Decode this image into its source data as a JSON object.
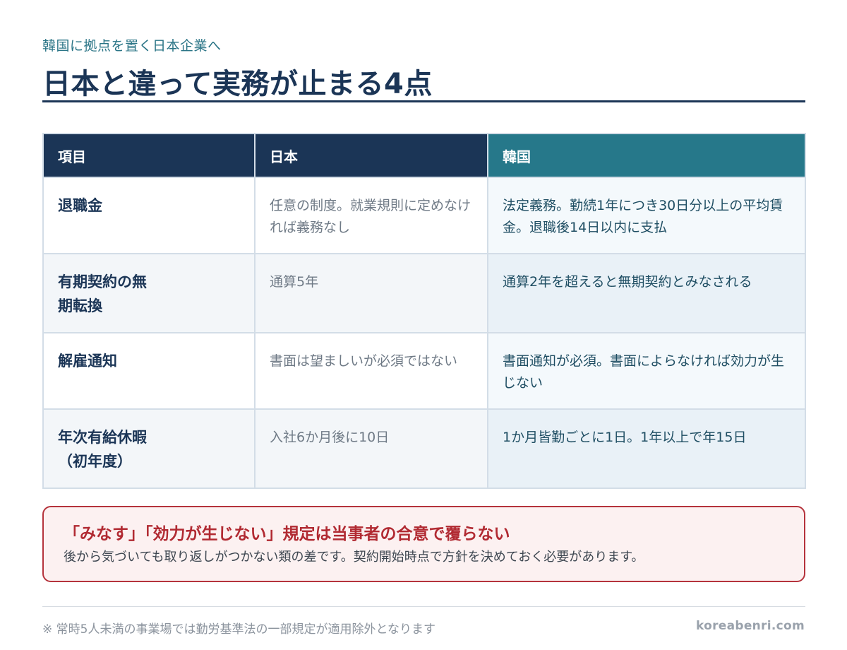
{
  "header": {
    "eyebrow": "韓国に拠点を置く日本企業へ",
    "title": "日本と違って実務が止まる4点"
  },
  "table": {
    "columns": [
      "項目",
      "日本",
      "韓国"
    ],
    "rows": [
      {
        "item": "退職金",
        "japan": "任意の制度。就業規則に定めなければ義務なし",
        "korea": "法定義務。勤続1年につき30日分以上の平均賃金。退職後14日以内に支払"
      },
      {
        "item": "有期契約の無期転換",
        "japan": "通算5年",
        "korea": "通算2年を超えると無期契約とみなされる"
      },
      {
        "item": "解雇通知",
        "japan": "書面は望ましいが必須ではない",
        "korea": "書面通知が必須。書面によらなければ効力が生じない"
      },
      {
        "item": "年次有給休暇（初年度）",
        "japan": "入社6か月後に10日",
        "korea": "1か月皆勤ごとに1日。1年以上で年15日"
      }
    ]
  },
  "callout": {
    "title": "「みなす」「効力が生じない」規定は当事者の合意で覆らない",
    "body": "後から気づいても取り返しがつかない類の差です。契約開始時点で方針を決めておく必要があります。"
  },
  "footer": {
    "note": "※ 常時5人未満の事業場では勤労基準法の一部規定が適用除外となります",
    "site": "koreabenri.com"
  },
  "colors": {
    "navy": "#1b3556",
    "teal": "#26788a",
    "alert_red": "#b12a32",
    "alert_bg": "#fcf1f1"
  }
}
